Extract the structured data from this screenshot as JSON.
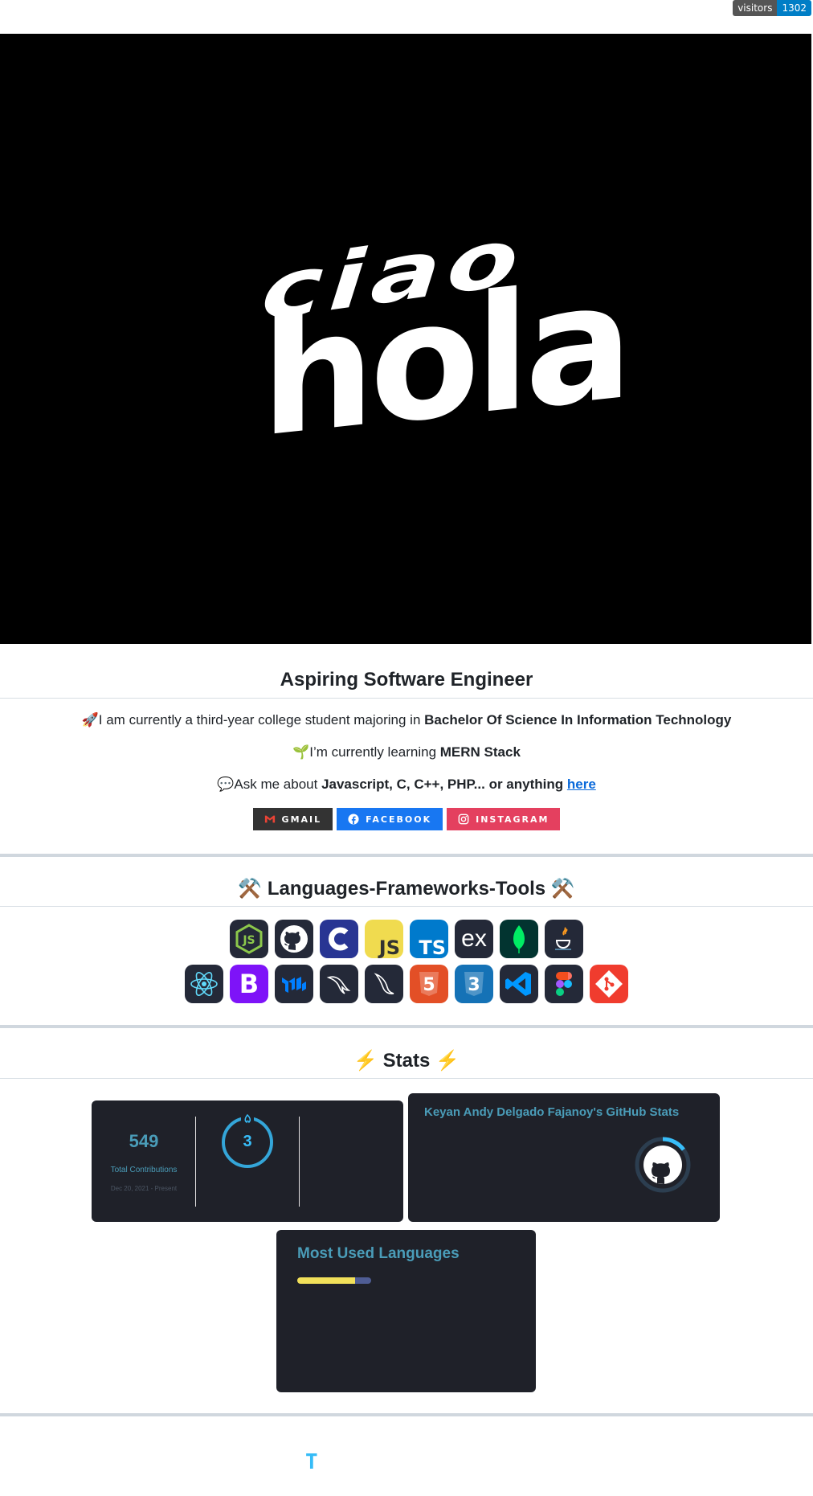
{
  "visitors": {
    "label": "visitors",
    "count": "1302"
  },
  "hero": {
    "word1": "ciao",
    "word2": "hola"
  },
  "about": {
    "title": "Aspiring Software Engineer",
    "line1": {
      "emoji": "🚀",
      "text": "I am currently a third-year college student majoring in ",
      "bold": "Bachelor Of Science In Information Technology"
    },
    "line2": {
      "emoji": "🌱",
      "text": "I’m currently learning ",
      "bold": "MERN Stack"
    },
    "line3": {
      "emoji": "💬",
      "text": "Ask me about ",
      "bold": "Javascript, C, C++, PHP... or anything ",
      "link": "here"
    }
  },
  "socials": [
    {
      "label": "GMAIL",
      "color": "#333333",
      "icon": "gmail-icon"
    },
    {
      "label": "FACEBOOK",
      "color": "#1877f2",
      "icon": "facebook-icon"
    },
    {
      "label": "INSTAGRAM",
      "color": "#e4405f",
      "icon": "instagram-icon"
    }
  ],
  "tools": {
    "title": "⚒️ Languages-Frameworks-Tools ⚒️",
    "row1": [
      "nodejs",
      "github",
      "c",
      "javascript",
      "typescript",
      "express",
      "mongodb",
      "java"
    ],
    "row2": [
      "react",
      "bootstrap",
      "materialui",
      "mysql",
      "flask",
      "html5",
      "css3",
      "vscode",
      "figma",
      "git"
    ]
  },
  "stats": {
    "title": "⚡ Stats ⚡",
    "streak": {
      "total": "549",
      "total_label": "Total Contributions",
      "range": "Dec 20, 2021 - Present",
      "current": "3"
    },
    "github": {
      "title": "Keyan Andy Delgado Fajanoy's GitHub Stats"
    },
    "languages": {
      "title": "Most Used Languages",
      "bar": [
        {
          "color": "#f1e05a",
          "fraction": 0.78
        },
        {
          "color": "#4F5D95",
          "fraction": 0.22
        }
      ]
    }
  },
  "footer": {
    "glyph": "T"
  }
}
